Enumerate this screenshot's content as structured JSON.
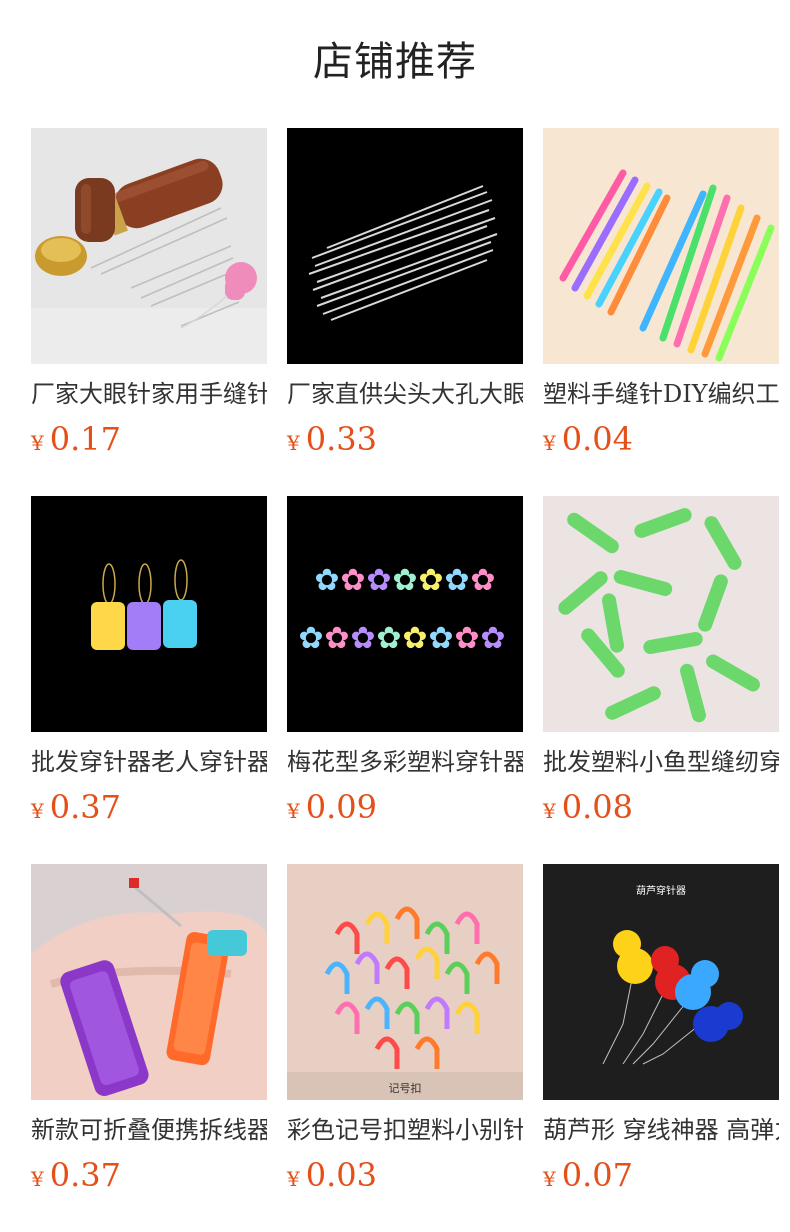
{
  "page": {
    "title": "店铺推荐"
  },
  "colors": {
    "price": "#e4501a",
    "title": "#222222",
    "text": "#333333"
  },
  "products": [
    {
      "name": "厂家大眼针家用手缝针",
      "currency": "¥",
      "price": "0.17",
      "image": "wooden-needle-case"
    },
    {
      "name": "厂家直供尖头大孔大眼针",
      "currency": "¥",
      "price": "0.33",
      "image": "steel-needles-black"
    },
    {
      "name": "塑料手缝针DIY编织工具",
      "currency": "¥",
      "price": "0.04",
      "image": "colorful-plastic-needles"
    },
    {
      "name": "批发穿针器老人穿针器",
      "currency": "¥",
      "price": "0.37",
      "image": "tag-threaders"
    },
    {
      "name": "梅花型多彩塑料穿针器",
      "currency": "¥",
      "price": "0.09",
      "image": "flower-threaders"
    },
    {
      "name": "批发塑料小鱼型缝纫穿针",
      "currency": "¥",
      "price": "0.08",
      "image": "green-fish-threaders"
    },
    {
      "name": "新款可折叠便携拆线器",
      "currency": "¥",
      "price": "0.37",
      "image": "folding-seam-rippers"
    },
    {
      "name": "彩色记号扣塑料小别针",
      "currency": "¥",
      "price": "0.03",
      "image": "stitch-markers",
      "image_caption": "记号扣"
    },
    {
      "name": "葫芦形 穿线神器 高弹力",
      "currency": "¥",
      "price": "0.07",
      "image": "gourd-threaders",
      "image_caption": "葫芦穿针器"
    }
  ]
}
